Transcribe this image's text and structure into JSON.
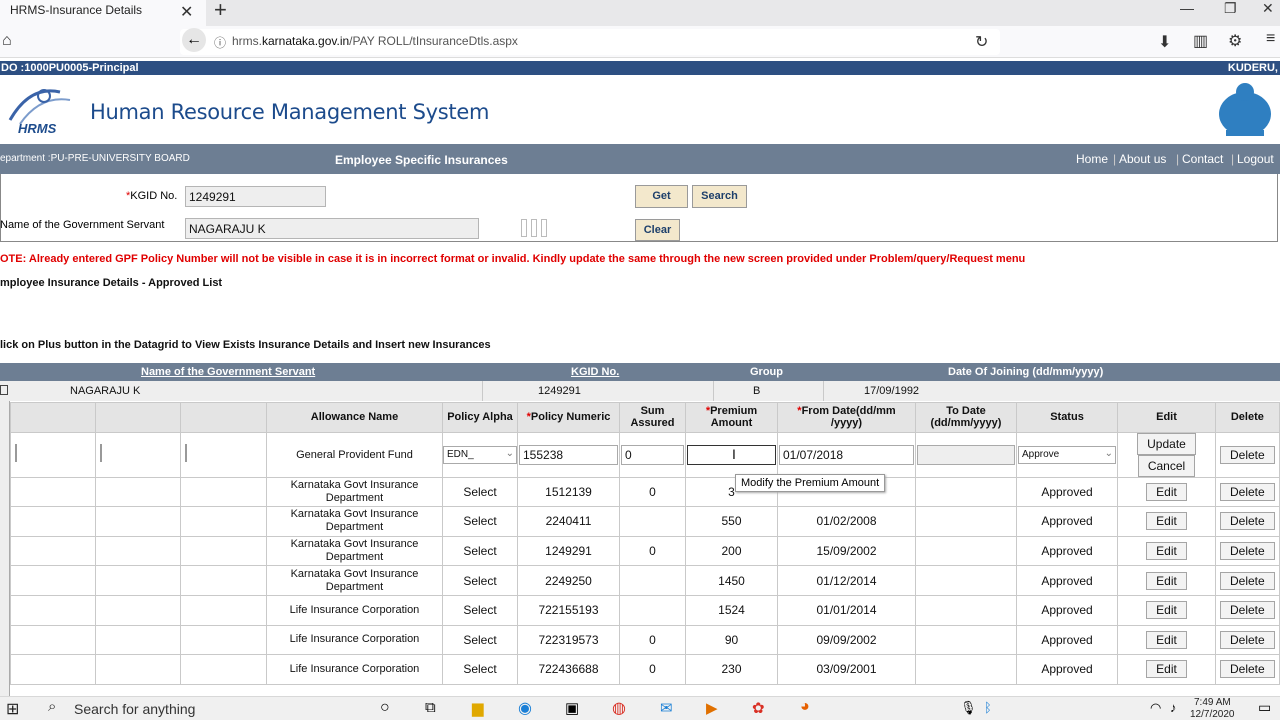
{
  "browser": {
    "tab_title": "HRMS-Insurance Details",
    "url_prefix": "hrms.",
    "url_domain": "karnataka.gov.in",
    "url_path": "/PAY ROLL/tInsuranceDtls.aspx"
  },
  "topbar": {
    "left": "DO :1000PU0005-Principal",
    "right": "KUDERU,"
  },
  "header": {
    "title": "Human Resource Management System",
    "logo_text": "HRMS"
  },
  "subbar": {
    "department": "epartment :PU-PRE-UNIVERSITY BOARD",
    "page_title": "Employee Specific Insurances",
    "links": [
      "Home",
      "About us",
      "Contact",
      "Logout"
    ]
  },
  "form": {
    "kgid_label": "KGID No.",
    "kgid_value": "1249291",
    "name_label": "Name of the Government Servant",
    "name_value": "NAGARAJU K",
    "get_label": "Get",
    "search_label": "Search",
    "clear_label": "Clear"
  },
  "note": "OTE: Already entered GPF Policy Number will not be visible in case it is in incorrect format or invalid. Kindly update the same through the new screen provided under Problem/query/Request menu",
  "approved_list_label": "mployee Insurance Details - Approved List",
  "click_hint": "lick on Plus button in the Datagrid to View Exists Insurance Details and Insert new Insurances",
  "grid": {
    "headers": [
      "Name of the Government Servant",
      "KGID No.",
      "Group",
      "Date Of Joining (dd/mm/yyyy)"
    ],
    "row": [
      "NAGARAJU K",
      "1249291",
      "B",
      "17/09/1992"
    ]
  },
  "inner": {
    "headers": {
      "allowance": "Allowance Name",
      "alpha": "Policy Alpha",
      "numeric": "Policy Numeric",
      "sum": "Sum Assured",
      "premium": "Premium Amount",
      "from": "From Date(dd/mm /yyyy)",
      "to": "To Date (dd/mm/yyyy)",
      "status": "Status",
      "edit": "Edit",
      "delete": "Delete"
    },
    "edit_row": {
      "allowance": "General Provident Fund",
      "alpha": "EDN_",
      "numeric": "155238",
      "sum": "0",
      "premium": "",
      "from": "01/07/2018",
      "to": "",
      "status": "Approve",
      "update": "Update",
      "cancel": "Cancel",
      "delete": "Delete"
    },
    "tooltip": "Modify the Premium Amount",
    "rows": [
      {
        "allowance": "Karnataka Govt Insurance Department",
        "alpha": "Select",
        "numeric": "1512139",
        "sum": "0",
        "premium": "3",
        "from": "",
        "status": "Approved"
      },
      {
        "allowance": "Karnataka Govt Insurance Department",
        "alpha": "Select",
        "numeric": "2240411",
        "sum": "",
        "premium": "550",
        "from": "01/02/2008",
        "status": "Approved"
      },
      {
        "allowance": "Karnataka Govt Insurance Department",
        "alpha": "Select",
        "numeric": "1249291",
        "sum": "0",
        "premium": "200",
        "from": "15/09/2002",
        "status": "Approved"
      },
      {
        "allowance": "Karnataka Govt Insurance Department",
        "alpha": "Select",
        "numeric": "2249250",
        "sum": "",
        "premium": "1450",
        "from": "01/12/2014",
        "status": "Approved"
      },
      {
        "allowance": "Life Insurance Corporation",
        "alpha": "Select",
        "numeric": "722155193",
        "sum": "",
        "premium": "1524",
        "from": "01/01/2014",
        "status": "Approved"
      },
      {
        "allowance": "Life Insurance Corporation",
        "alpha": "Select",
        "numeric": "722319573",
        "sum": "0",
        "premium": "90",
        "from": "09/09/2002",
        "status": "Approved"
      },
      {
        "allowance": "Life Insurance Corporation",
        "alpha": "Select",
        "numeric": "722436688",
        "sum": "0",
        "premium": "230",
        "from": "03/09/2001",
        "status": "Approved"
      }
    ],
    "edit_label": "Edit",
    "delete_label": "Delete"
  },
  "taskbar": {
    "search": "Search for anything",
    "time": "7:49 AM",
    "date": "12/7/2020"
  }
}
